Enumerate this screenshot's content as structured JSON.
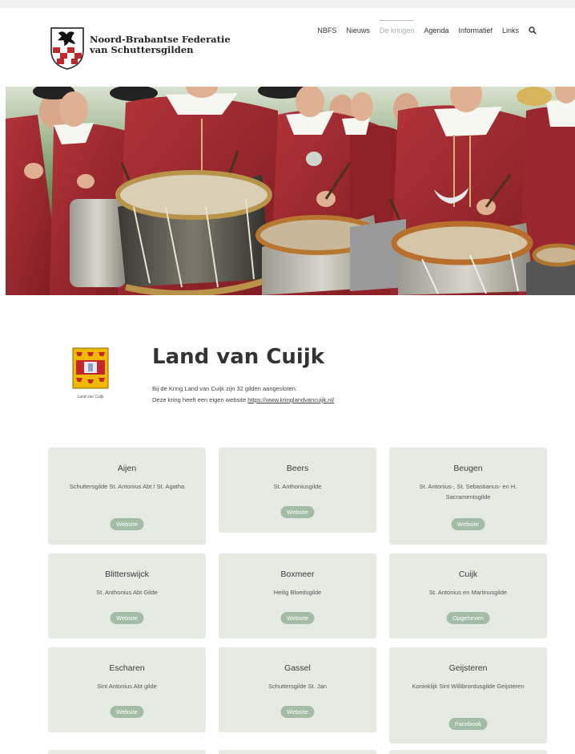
{
  "site": {
    "name_line1": "Noord-Brabantse Federatie",
    "name_line2": "van Schuttersgilden"
  },
  "nav": {
    "items": [
      {
        "label": "NBFS"
      },
      {
        "label": "Nieuws"
      },
      {
        "label": "De kringen"
      },
      {
        "label": "Agenda"
      },
      {
        "label": "Informatief"
      },
      {
        "label": "Links"
      }
    ],
    "active": "De kringen"
  },
  "district": {
    "logo_caption": "Land van Cuijk",
    "title": "Land van Cuijk",
    "text1": "Bij de Kring Land van Cuijk zijn 32 gilden aangesloten.",
    "text2_prefix": "Deze kring heeft een eigen website ",
    "link": "https://www.kringlandvancuijk.nl/"
  },
  "guilds": [
    {
      "place": "Aijen",
      "guild": "Schuttersgilde St. Antonius Abt / St. Agatha",
      "button": "Website"
    },
    {
      "place": "Beers",
      "guild": "St. Anthoniusgilde",
      "button": "Website"
    },
    {
      "place": "Beugen",
      "guild": "St. Antonius-, St. Sebastianus- en H. Sacramentsgilde",
      "button": "Website"
    },
    {
      "place": "Blitterswijck",
      "guild": "St. Anthonius Abt Gilde",
      "button": "Website"
    },
    {
      "place": "Boxmeer",
      "guild": "Heilig Bloedsgilde",
      "button": "Website"
    },
    {
      "place": "Cuijk",
      "guild": "St. Antonius en Martinusgilde",
      "button": "Opgeheven"
    },
    {
      "place": "Escharen",
      "guild": "Sint Antonius Abt gilde",
      "button": "Website"
    },
    {
      "place": "Gassel",
      "guild": "Schuttersgilde St. Jan",
      "button": "Website"
    },
    {
      "place": "Geijsteren",
      "guild": "Koninklijk Sint Willibrordusgilde Geijsteren",
      "button": "Facebook"
    }
  ],
  "icons": {
    "search": "search-icon",
    "logo": "federation-crest-icon",
    "district_logo": "district-coat-of-arms-icon"
  },
  "colors": {
    "card_bg": "#e5ebe2",
    "button_bg": "#a3bca6",
    "robe_red": "#a4262c"
  }
}
